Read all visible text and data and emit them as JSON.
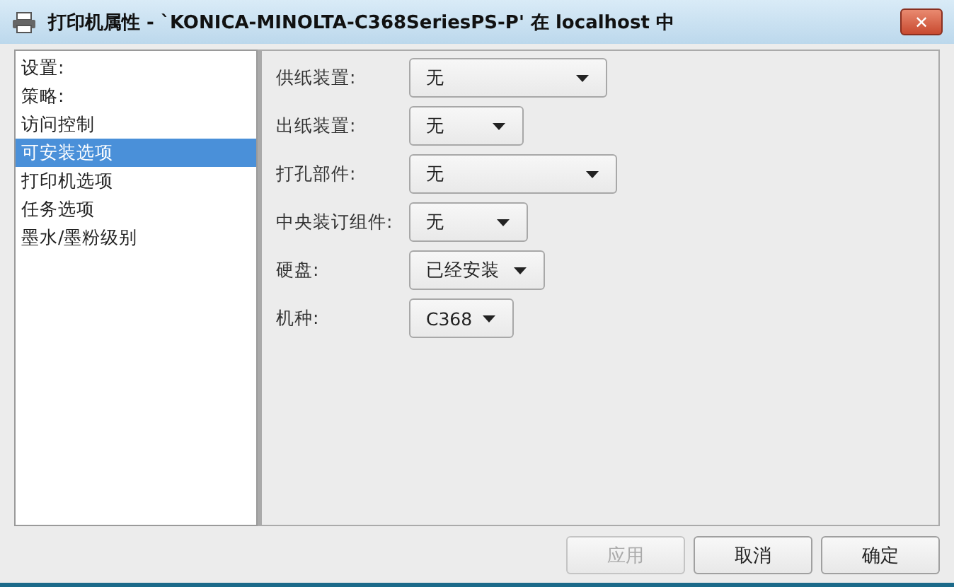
{
  "window": {
    "title": "打印机属性 - `KONICA-MINOLTA-C368SeriesPS-P' 在 localhost 中",
    "close": "✕"
  },
  "sidebar": {
    "items": [
      {
        "label": "设置:",
        "selected": false
      },
      {
        "label": "策略:",
        "selected": false
      },
      {
        "label": "访问控制",
        "selected": false
      },
      {
        "label": "可安装选项",
        "selected": true
      },
      {
        "label": "打印机选项",
        "selected": false
      },
      {
        "label": "任务选项",
        "selected": false
      },
      {
        "label": "墨水/墨粉级别",
        "selected": false
      }
    ]
  },
  "options": [
    {
      "label": "供纸装置:",
      "value": "无"
    },
    {
      "label": "出纸装置:",
      "value": "无"
    },
    {
      "label": "打孔部件:",
      "value": "无"
    },
    {
      "label": "中央装订组件:",
      "value": "无"
    },
    {
      "label": "硬盘:",
      "value": "已经安装"
    },
    {
      "label": "机种:",
      "value": "C368"
    }
  ],
  "buttons": [
    {
      "label": "应用",
      "disabled": true
    },
    {
      "label": "取消",
      "disabled": false
    },
    {
      "label": "确定",
      "disabled": false
    }
  ]
}
